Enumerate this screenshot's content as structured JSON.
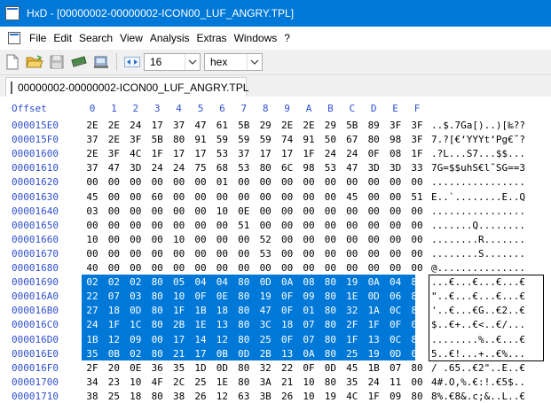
{
  "window": {
    "title": "HxD - [00000002-00000002-ICON00_LUF_ANGRY.TPL]"
  },
  "menu": {
    "items": [
      "File",
      "Edit",
      "Search",
      "View",
      "Analysis",
      "Extras",
      "Windows",
      "?"
    ]
  },
  "toolbar": {
    "bytes_per_row": "16",
    "display_mode": "hex"
  },
  "tab": {
    "label": "00000002-00000002-ICON00_LUF_ANGRY.TPL"
  },
  "hex": {
    "header_offset": "Offset",
    "header_cols": [
      "0",
      "1",
      "2",
      "3",
      "4",
      "5",
      "6",
      "7",
      "8",
      "9",
      "A",
      "B",
      "C",
      "D",
      "E",
      "F"
    ],
    "selection_rows": [
      11,
      16
    ],
    "rows": [
      {
        "offset": "000015E0",
        "bytes": [
          "2E",
          "2E",
          "24",
          "17",
          "37",
          "47",
          "61",
          "5B",
          "29",
          "2E",
          "2E",
          "29",
          "5B",
          "89",
          "3F",
          "3F"
        ],
        "ascii": "..$.7Ga[)..)[‰??"
      },
      {
        "offset": "000015F0",
        "bytes": [
          "37",
          "2E",
          "3F",
          "5B",
          "80",
          "91",
          "59",
          "59",
          "59",
          "74",
          "91",
          "50",
          "67",
          "80",
          "98",
          "3F"
        ],
        "ascii": "7.?[€‘YYYt‘Pg€˜?"
      },
      {
        "offset": "00001600",
        "bytes": [
          "2E",
          "3F",
          "4C",
          "1F",
          "17",
          "17",
          "53",
          "37",
          "17",
          "17",
          "1F",
          "24",
          "24",
          "0F",
          "08",
          "1F"
        ],
        "ascii": ".?L...S7...$$..."
      },
      {
        "offset": "00001610",
        "bytes": [
          "37",
          "47",
          "3D",
          "24",
          "24",
          "75",
          "68",
          "53",
          "80",
          "6C",
          "98",
          "53",
          "47",
          "3D",
          "3D",
          "33"
        ],
        "ascii": "7G=$$uhS€l˜SG==3"
      },
      {
        "offset": "00001620",
        "bytes": [
          "00",
          "00",
          "00",
          "00",
          "00",
          "00",
          "01",
          "00",
          "00",
          "00",
          "00",
          "00",
          "00",
          "00",
          "00",
          "00"
        ],
        "ascii": "................"
      },
      {
        "offset": "00001630",
        "bytes": [
          "45",
          "00",
          "00",
          "60",
          "00",
          "00",
          "00",
          "00",
          "00",
          "00",
          "00",
          "00",
          "45",
          "00",
          "00",
          "51"
        ],
        "ascii": "E..`........E..Q"
      },
      {
        "offset": "00001640",
        "bytes": [
          "03",
          "00",
          "00",
          "00",
          "00",
          "00",
          "10",
          "0E",
          "00",
          "00",
          "00",
          "00",
          "00",
          "00",
          "00",
          "00"
        ],
        "ascii": "................"
      },
      {
        "offset": "00001650",
        "bytes": [
          "00",
          "00",
          "00",
          "00",
          "00",
          "00",
          "00",
          "51",
          "00",
          "00",
          "00",
          "00",
          "00",
          "00",
          "00",
          "00"
        ],
        "ascii": ".......Q........"
      },
      {
        "offset": "00001660",
        "bytes": [
          "10",
          "00",
          "00",
          "00",
          "10",
          "00",
          "00",
          "00",
          "52",
          "00",
          "00",
          "00",
          "00",
          "00",
          "00",
          "00"
        ],
        "ascii": "........R......."
      },
      {
        "offset": "00001670",
        "bytes": [
          "00",
          "00",
          "00",
          "00",
          "00",
          "00",
          "00",
          "00",
          "53",
          "00",
          "00",
          "00",
          "00",
          "00",
          "00",
          "00"
        ],
        "ascii": "........S......."
      },
      {
        "offset": "00001680",
        "bytes": [
          "40",
          "00",
          "00",
          "00",
          "00",
          "00",
          "00",
          "00",
          "00",
          "00",
          "00",
          "00",
          "00",
          "00",
          "00",
          "00"
        ],
        "ascii": "@..............."
      },
      {
        "offset": "00001690",
        "bytes": [
          "02",
          "02",
          "02",
          "80",
          "05",
          "04",
          "04",
          "80",
          "0D",
          "0A",
          "08",
          "80",
          "19",
          "0A",
          "04",
          "80"
        ],
        "ascii": "...€...€...€...€"
      },
      {
        "offset": "000016A0",
        "bytes": [
          "22",
          "07",
          "03",
          "80",
          "10",
          "0F",
          "0E",
          "80",
          "19",
          "0F",
          "09",
          "80",
          "1E",
          "0D",
          "06",
          "80"
        ],
        "ascii": "\"..€...€...€...€"
      },
      {
        "offset": "000016B0",
        "bytes": [
          "27",
          "18",
          "0D",
          "80",
          "1F",
          "1B",
          "18",
          "80",
          "47",
          "0F",
          "01",
          "80",
          "32",
          "1A",
          "0C",
          "80"
        ],
        "ascii": "'..€...€G..€2..€"
      },
      {
        "offset": "000016C0",
        "bytes": [
          "24",
          "1F",
          "1C",
          "80",
          "2B",
          "1E",
          "13",
          "80",
          "3C",
          "18",
          "07",
          "80",
          "2F",
          "1F",
          "0F",
          "00"
        ],
        "ascii": "$..€+..€<..€/..."
      },
      {
        "offset": "000016D0",
        "bytes": [
          "1B",
          "12",
          "09",
          "00",
          "17",
          "14",
          "12",
          "80",
          "25",
          "0F",
          "07",
          "80",
          "1F",
          "13",
          "0C",
          "80"
        ],
        "ascii": "........%..€...€"
      },
      {
        "offset": "000016E0",
        "bytes": [
          "35",
          "0B",
          "02",
          "80",
          "21",
          "17",
          "0B",
          "0D",
          "2B",
          "13",
          "0A",
          "80",
          "25",
          "19",
          "0D",
          "00"
        ],
        "ascii": "5..€!...+..€%..."
      },
      {
        "offset": "000016F0",
        "bytes": [
          "2F",
          "20",
          "0E",
          "36",
          "35",
          "1D",
          "0D",
          "80",
          "32",
          "22",
          "0F",
          "0D",
          "45",
          "1B",
          "07",
          "80"
        ],
        "ascii": "/ .65..€2\"..E..€"
      },
      {
        "offset": "00001700",
        "bytes": [
          "34",
          "23",
          "10",
          "4F",
          "2C",
          "25",
          "1E",
          "80",
          "3A",
          "21",
          "10",
          "80",
          "35",
          "24",
          "11",
          "00"
        ],
        "ascii": "4#.O,%.€:!.€5$.."
      },
      {
        "offset": "00001710",
        "bytes": [
          "38",
          "25",
          "18",
          "80",
          "38",
          "26",
          "12",
          "63",
          "3B",
          "26",
          "10",
          "19",
          "4C",
          "1F",
          "09",
          "80"
        ],
        "ascii": "8%.€8&.c;&..L..€"
      }
    ]
  }
}
